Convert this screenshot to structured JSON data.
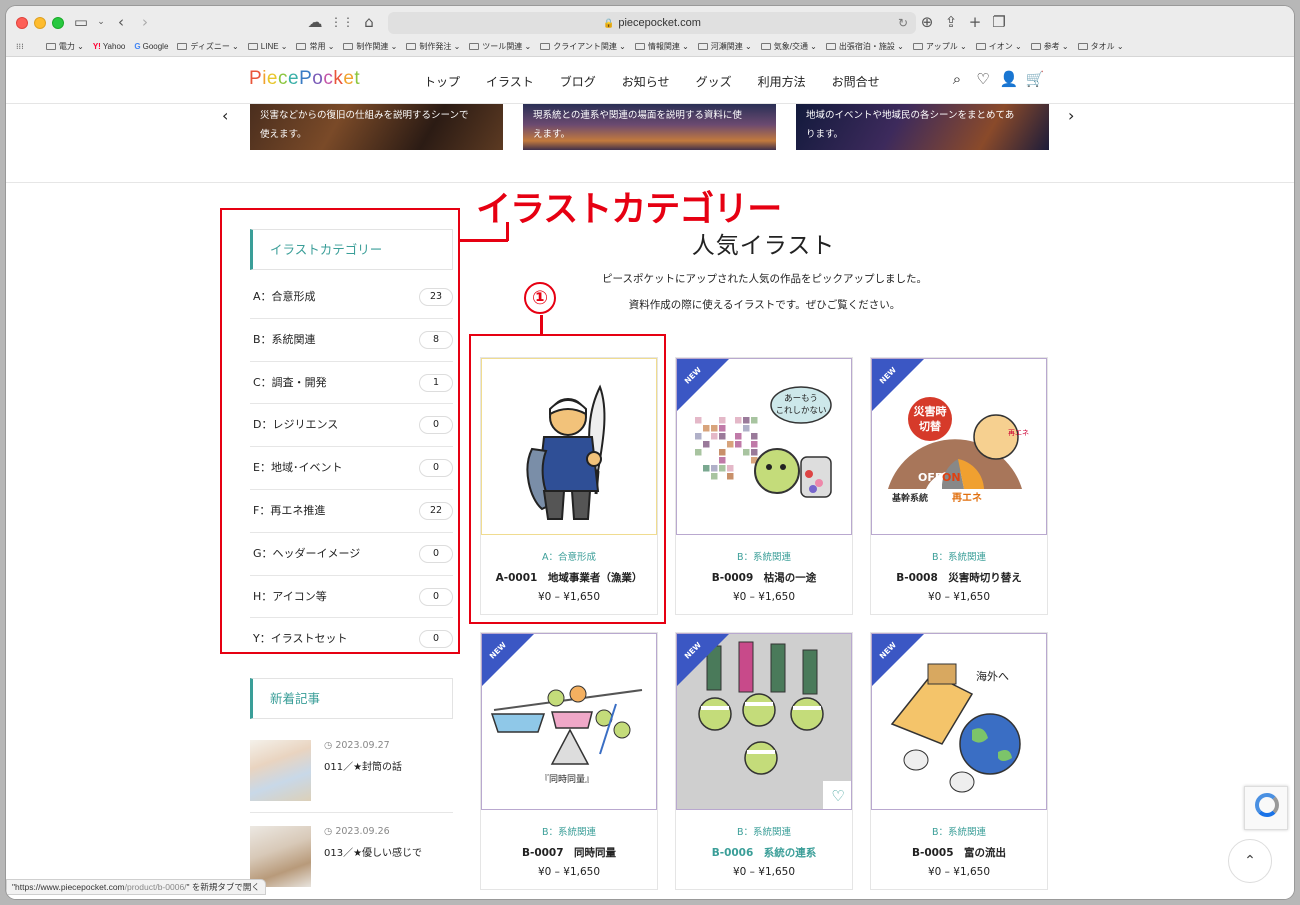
{
  "browser": {
    "url": "piecepocket.com",
    "bookmarks": [
      {
        "label": "電力",
        "type": "folder"
      },
      {
        "label": "Yahoo",
        "type": "yahoo"
      },
      {
        "label": "Google",
        "type": "google"
      },
      {
        "label": "ディズニー",
        "type": "folder"
      },
      {
        "label": "LINE",
        "type": "folder"
      },
      {
        "label": "常用",
        "type": "folder"
      },
      {
        "label": "制作関連",
        "type": "folder"
      },
      {
        "label": "制作発注",
        "type": "folder"
      },
      {
        "label": "ツール関連",
        "type": "folder"
      },
      {
        "label": "クライアント関連",
        "type": "folder"
      },
      {
        "label": "情報関連",
        "type": "folder"
      },
      {
        "label": "河瀬関連",
        "type": "folder"
      },
      {
        "label": "気象/交通",
        "type": "folder"
      },
      {
        "label": "出張宿泊・施設",
        "type": "folder"
      },
      {
        "label": "アップル",
        "type": "folder"
      },
      {
        "label": "イオン",
        "type": "folder"
      },
      {
        "label": "参考",
        "type": "folder"
      },
      {
        "label": "タオル",
        "type": "folder"
      }
    ],
    "status_url": "\"https://www.piecepocket.com",
    "status_path": "/product/b-0006/",
    "status_suffix": "\" を新規タブで開く"
  },
  "site": {
    "logo_letters": [
      {
        "ch": "P",
        "color": "#e9553a"
      },
      {
        "ch": "i",
        "color": "#f0a22e"
      },
      {
        "ch": "e",
        "color": "#e8c62a"
      },
      {
        "ch": "c",
        "color": "#8cc63f"
      },
      {
        "ch": "e",
        "color": "#3ab0a8"
      },
      {
        "ch": "P",
        "color": "#3a7cc4"
      },
      {
        "ch": "o",
        "color": "#7a5bb8"
      },
      {
        "ch": "c",
        "color": "#c455a8"
      },
      {
        "ch": "k",
        "color": "#e9553a"
      },
      {
        "ch": "e",
        "color": "#f0a22e"
      },
      {
        "ch": "t",
        "color": "#8cc63f"
      }
    ],
    "nav": [
      "トップ",
      "イラスト",
      "ブログ",
      "お知らせ",
      "グッズ",
      "利用方法",
      "お問合せ"
    ]
  },
  "banners": [
    {
      "text1": "災害などからの復旧の仕組みを説明するシーンで",
      "text2": "使えます。"
    },
    {
      "text1": "現系統との連系や関連の場面を説明する資料に使",
      "text2": "えます。"
    },
    {
      "text1": "地域のイベントや地域民の各シーンをまとめてあ",
      "text2": "ります。"
    }
  ],
  "annotation": {
    "title": "イラストカテゴリー",
    "number": "①"
  },
  "sidebar": {
    "heading": "イラストカテゴリー",
    "categories": [
      {
        "label": "A：合意形成",
        "count": "23"
      },
      {
        "label": "B：系統関連",
        "count": "8"
      },
      {
        "label": "C：調査・開発",
        "count": "1"
      },
      {
        "label": "D：レジリエンス",
        "count": "0"
      },
      {
        "label": "E：地域･イベント",
        "count": "0"
      },
      {
        "label": "F：再エネ推進",
        "count": "22"
      },
      {
        "label": "G：ヘッダーイメージ",
        "count": "0"
      },
      {
        "label": "H：アイコン等",
        "count": "0"
      },
      {
        "label": "Y：イラストセット",
        "count": "0"
      }
    ],
    "news_heading": "新着記事",
    "news": [
      {
        "date": "2023.09.27",
        "title": "011／★封筒の話"
      },
      {
        "date": "2023.09.26",
        "title": "013／★優しい感じで"
      }
    ]
  },
  "main": {
    "title": "人気イラスト",
    "desc1": "ピースポケットにアップされた人気の作品をピックアップしました。",
    "desc2": "資料作成の際に使えるイラストです。ぜひご覧ください。",
    "badge": "NEW",
    "cards": [
      {
        "category": "A：合意形成",
        "title": "A-0001　地域事業者（漁業）",
        "price": "¥0 – ¥1,650",
        "is_new": false
      },
      {
        "category": "B：系統関連",
        "title": "B-0009　枯渇の一途",
        "price": "¥0 – ¥1,650",
        "is_new": true,
        "bubble": "あーもう\nこれしかない"
      },
      {
        "category": "B：系統関連",
        "title": "B-0008　災害時切り替え",
        "price": "¥0 – ¥1,650",
        "is_new": true,
        "sign1": "災害時",
        "sign2": "切替",
        "off": "OFF",
        "on": "ON",
        "left_label": "基幹系統",
        "right_label": "再エネ",
        "ball": "再エネ"
      },
      {
        "category": "B：系統関連",
        "title": "B-0007　同時同量",
        "price": "¥0 – ¥1,650",
        "is_new": true,
        "caption": "『同時同量』"
      },
      {
        "category": "B：系統関連",
        "title": "B-0006　系統の連系",
        "price": "¥0 – ¥1,650",
        "is_new": true
      },
      {
        "category": "B：系統関連",
        "title": "B-0005　富の流出",
        "price": "¥0 – ¥1,650",
        "is_new": true,
        "label": "海外へ"
      }
    ]
  }
}
